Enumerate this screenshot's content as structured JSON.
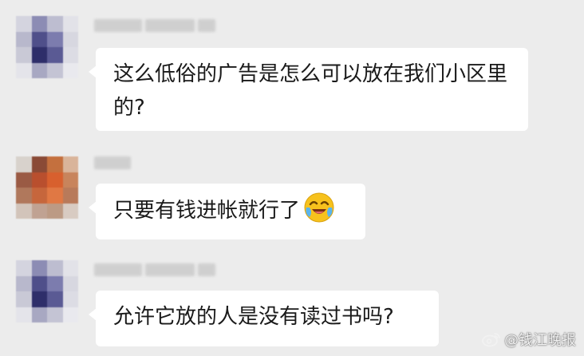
{
  "messages": [
    {
      "text": "这么低俗的广告是怎么可以放在我们小区里的?",
      "avatar_colors": [
        "#d4d4df",
        "#8c8cb4",
        "#bdbdd0",
        "#e2e2e8",
        "#b8b8cc",
        "#4f4f8a",
        "#7c7cae",
        "#d7d7e0",
        "#c9c9d6",
        "#2e2e6a",
        "#5a5a94",
        "#dcdce4",
        "#e4e4ea",
        "#a8a8c2",
        "#c4c4d4",
        "#e9e9ee"
      ]
    },
    {
      "text": "只要有钱进帐就行了",
      "emoji": "crying-laughing-face-icon",
      "avatar_colors": [
        "#d8d2cc",
        "#8a4a36",
        "#c4703e",
        "#d9b49a",
        "#9a5a44",
        "#b94f2e",
        "#d8602e",
        "#c8845c",
        "#b0785c",
        "#c6663c",
        "#e07844",
        "#b87a5a",
        "#d2c4ba",
        "#c0a292",
        "#bc9a84",
        "#d8cbc2"
      ]
    },
    {
      "text": "允许它放的人是没有读过书吗?",
      "avatar_colors": [
        "#d4d4df",
        "#8c8cb4",
        "#bdbdd0",
        "#e2e2e8",
        "#b8b8cc",
        "#4f4f8a",
        "#7c7cae",
        "#d7d7e0",
        "#c9c9d6",
        "#2e2e6a",
        "#5a5a94",
        "#dcdce4",
        "#e4e4ea",
        "#a8a8c2",
        "#c4c4d4",
        "#e9e9ee"
      ]
    }
  ],
  "watermark": {
    "icon": "weibo-icon",
    "text": "@钱江晚报"
  },
  "colors": {
    "background": "#ececec",
    "bubble": "#ffffff",
    "text": "#1a1a1a"
  }
}
